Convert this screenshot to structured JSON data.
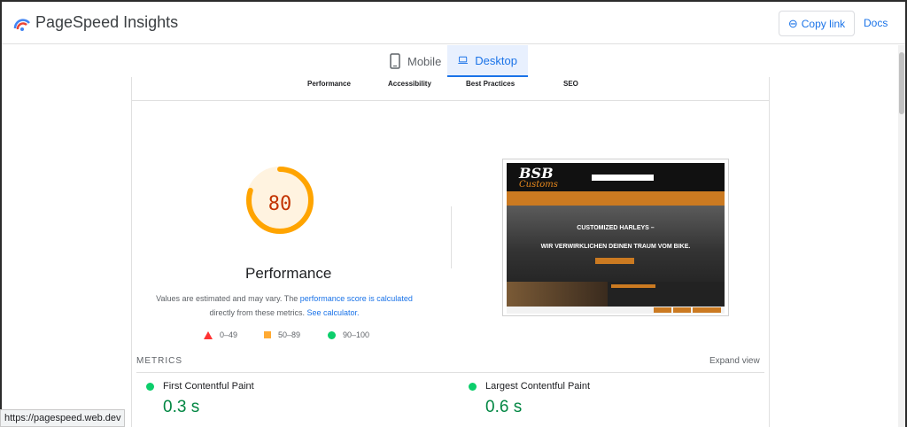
{
  "header": {
    "app_title": "PageSpeed Insights",
    "copy_link_label": "Copy link",
    "docs_label": "Docs"
  },
  "device_tabs": [
    {
      "label": "Mobile",
      "icon": "phone-icon",
      "selected": false
    },
    {
      "label": "Desktop",
      "icon": "laptop-icon",
      "selected": true
    }
  ],
  "category_tabs": [
    "Performance",
    "Accessibility",
    "Best Practices",
    "SEO"
  ],
  "performance": {
    "score": "80",
    "score_value": 80,
    "title": "Performance",
    "desc_1": "Values are estimated and may vary. The ",
    "desc_link_1": "performance score is calculated",
    "desc_2": "directly from these metrics. ",
    "desc_link_2": "See calculator.",
    "legend": [
      {
        "label": "0–49",
        "color": "#ff3333"
      },
      {
        "label": "50–89",
        "color": "#ffaa33"
      },
      {
        "label": "90–100",
        "color": "#0cce6b"
      }
    ]
  },
  "screenshot": {
    "logo": "BSB",
    "logo_sub": "Customs",
    "hero_line_1": "CUSTOMIZED HARLEYS –",
    "hero_line_2": "WIR VERWIRKLICHEN DEINEN TRAUM VOM BIKE."
  },
  "metrics": {
    "section_label": "METRICS",
    "expand_label": "Expand view",
    "items": [
      {
        "name": "First Contentful Paint",
        "value": "0.3 s"
      },
      {
        "name": "Largest Contentful Paint",
        "value": "0.6 s"
      }
    ]
  },
  "status_bar": {
    "url": "https://pagespeed.web.dev"
  },
  "colors": {
    "accent": "#1a73e8",
    "average": "#ffaa33",
    "pass": "#0cce6b",
    "fail": "#ff3333"
  }
}
